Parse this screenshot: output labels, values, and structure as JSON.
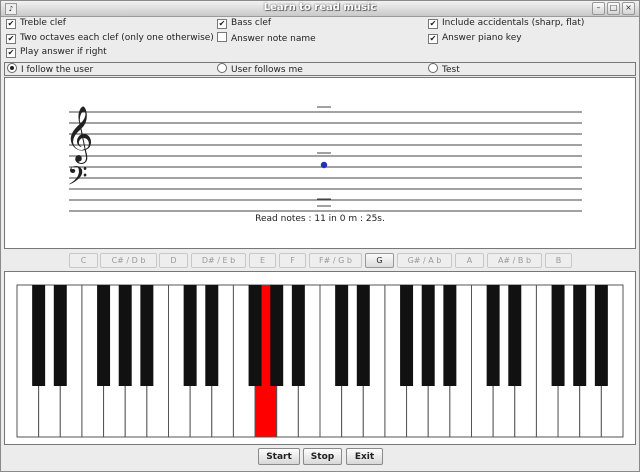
{
  "window": {
    "title": "Learn to read music",
    "icon": "app-icon",
    "controls": [
      "minimize-icon",
      "maximize-icon",
      "close-icon"
    ]
  },
  "options": [
    {
      "label": "Treble clef",
      "checked": true
    },
    {
      "label": "Bass clef",
      "checked": true
    },
    {
      "label": "Include accidentals (sharp, flat)",
      "checked": true
    },
    {
      "label": "Two octaves each clef (only one otherwise)",
      "checked": true
    },
    {
      "label": "Answer note name",
      "checked": false
    },
    {
      "label": "Answer piano key",
      "checked": true
    },
    {
      "label": "Play answer if right",
      "checked": true
    }
  ],
  "modes": [
    {
      "label": "I follow the user",
      "selected": true
    },
    {
      "label": "User follows me",
      "selected": false
    },
    {
      "label": "Test",
      "selected": false
    }
  ],
  "staff": {
    "treble_clef_glyph": "𝄞",
    "bass_clef_glyph": "𝄢",
    "note_color": "#1f2fbf",
    "status": "Read notes : 11 in 0 m : 25s."
  },
  "note_buttons": [
    {
      "label": "C",
      "active": false
    },
    {
      "label": "C# / D b",
      "active": false
    },
    {
      "label": "D",
      "active": false
    },
    {
      "label": "D# / E b",
      "active": false
    },
    {
      "label": "E",
      "active": false
    },
    {
      "label": "F",
      "active": false
    },
    {
      "label": "F# / G b",
      "active": false
    },
    {
      "label": "G",
      "active": true
    },
    {
      "label": "G# / A b",
      "active": false
    },
    {
      "label": "A",
      "active": false
    },
    {
      "label": "A# / B b",
      "active": false
    },
    {
      "label": "B",
      "active": false
    }
  ],
  "piano": {
    "highlight_color": "#ff0000",
    "highlighted_key": "G"
  },
  "controls": {
    "start_label": "Start",
    "stop_label": "Stop",
    "exit_label": "Exit"
  }
}
